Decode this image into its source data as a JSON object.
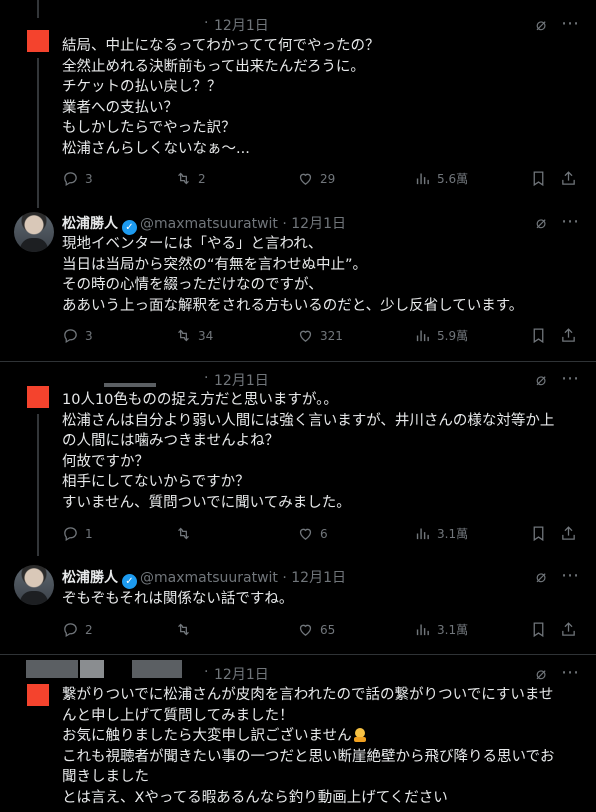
{
  "tweets": [
    {
      "author": "",
      "handle": "",
      "date": "12月1日",
      "lines": [
        "結局、中止になるってわかってて何でやったの？",
        "全然止めれる決断前もって出来たんだろうに。",
        "チケットの払い戻し？？",
        "業者への支払い？",
        "もしかしたらでやった訳？",
        "松浦さんらしくないなぁ〜..."
      ],
      "replies": "3",
      "reposts": "2",
      "likes": "29",
      "views": "5.6萬"
    },
    {
      "author": "松浦勝人",
      "handle": "@maxmatsuuratwit",
      "date": "12月1日",
      "lines": [
        "現地イベンターには「やる」と言われ、",
        "当日は当局から突然の“有無を言わせぬ中止”。",
        "その時の心情を綴っただけなのですが、",
        "ああいう上っ面な解釈をされる方もいるのだと、少し反省しています。"
      ],
      "replies": "3",
      "reposts": "34",
      "likes": "321",
      "views": "5.9萬"
    },
    {
      "author": "",
      "handle": "",
      "date": "12月1日",
      "lines": [
        "10人10色ものの捉え方だと思いますが。。",
        "松浦さんは自分より弱い人間には強く言いますが、井川さんの様な対等か上",
        "の人間には噛みつきませんよね？",
        "何故ですか？",
        "相手にしてないからですか？",
        "すいません、質問ついでに聞いてみました。"
      ],
      "replies": "1",
      "reposts": "",
      "likes": "6",
      "views": "3.1萬"
    },
    {
      "author": "松浦勝人",
      "handle": "@maxmatsuuratwit",
      "date": "12月1日",
      "lines": [
        "ぞもぞもそれは関係ない話ですね。"
      ],
      "replies": "2",
      "reposts": "",
      "likes": "65",
      "views": "3.1萬"
    },
    {
      "author": "",
      "handle": "",
      "date": "12月1日",
      "lines": [
        "繋がりついでに松浦さんが皮肉を言われたので話の繋がりついでにすいませ",
        "んと申し上げて質問してみました！",
        "お気に触りましたら大変申し訳ございません",
        "これも視聴者が聞きたい事の一つだと思い断崖絶壁から飛び降りる思いでお",
        "聞きしました",
        "とは言え、Xやってる暇あるんなら釣り動画上げてください"
      ]
    }
  ],
  "icons": {
    "reply": "reply-icon",
    "repost": "repost-icon",
    "like": "like-icon",
    "views": "views-icon",
    "bookmark": "bookmark-icon",
    "share": "share-icon",
    "grok": "grok-icon",
    "more": "more-icon",
    "verified": "verified-badge-icon"
  },
  "colors": {
    "background": "#000000",
    "text": "#e7e9ea",
    "muted": "#71767b",
    "verified": "#1d9bf0",
    "avatar_red": "#f4432d"
  }
}
